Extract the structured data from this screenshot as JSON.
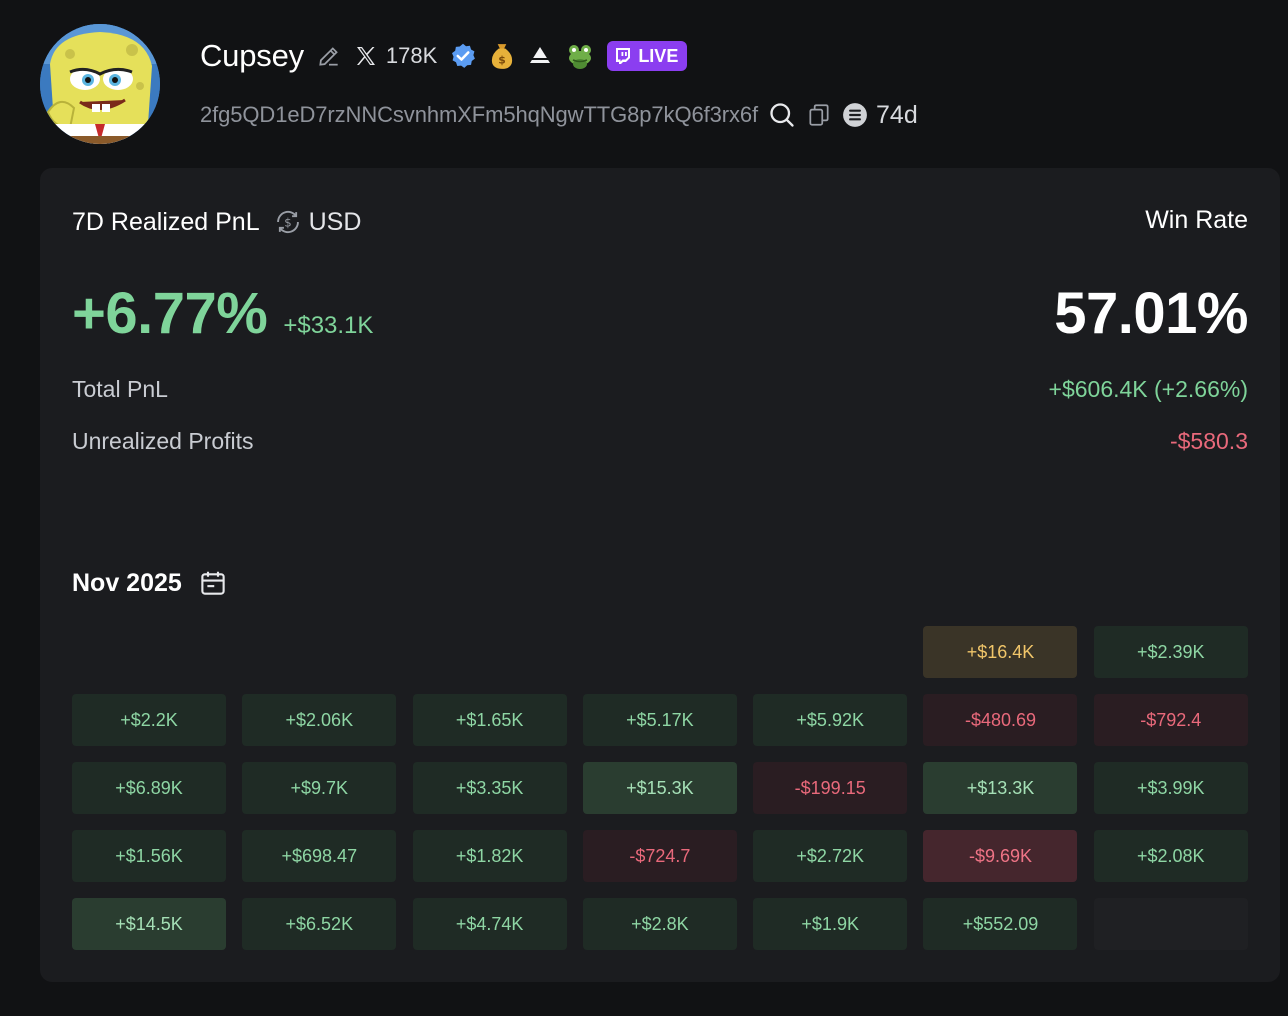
{
  "profile": {
    "name": "Cupsey",
    "followers": "178K",
    "live_label": "LIVE",
    "address": "2fg5QD1eD7rzNNCsvnhmXFm5hqNgwTTG8p7kQ6f3rx6f",
    "age": "74d"
  },
  "pnl": {
    "title": "7D Realized PnL",
    "currency": "USD",
    "percent": "+6.77%",
    "usd": "+$33.1K",
    "win_rate_label": "Win Rate",
    "win_rate": "57.01%",
    "total_label": "Total PnL",
    "total_value": "+$606.4K (+2.66%)",
    "unrealized_label": "Unrealized Profits",
    "unrealized_value": "-$580.3"
  },
  "calendar": {
    "month": "Nov 2025",
    "cells": [
      {
        "text": "",
        "kind": "empty"
      },
      {
        "text": "",
        "kind": "empty"
      },
      {
        "text": "",
        "kind": "empty"
      },
      {
        "text": "",
        "kind": "empty"
      },
      {
        "text": "",
        "kind": "empty"
      },
      {
        "text": "+$16.4K",
        "kind": "gold"
      },
      {
        "text": "+$2.39K",
        "kind": "pos"
      },
      {
        "text": "+$2.2K",
        "kind": "pos"
      },
      {
        "text": "+$2.06K",
        "kind": "pos"
      },
      {
        "text": "+$1.65K",
        "kind": "pos"
      },
      {
        "text": "+$5.17K",
        "kind": "pos"
      },
      {
        "text": "+$5.92K",
        "kind": "pos"
      },
      {
        "text": "-$480.69",
        "kind": "neg"
      },
      {
        "text": "-$792.4",
        "kind": "neg"
      },
      {
        "text": "+$6.89K",
        "kind": "pos"
      },
      {
        "text": "+$9.7K",
        "kind": "pos"
      },
      {
        "text": "+$3.35K",
        "kind": "pos"
      },
      {
        "text": "+$15.3K",
        "kind": "pos hi"
      },
      {
        "text": "-$199.15",
        "kind": "neg"
      },
      {
        "text": "+$13.3K",
        "kind": "pos hi"
      },
      {
        "text": "+$3.99K",
        "kind": "pos"
      },
      {
        "text": "+$1.56K",
        "kind": "pos"
      },
      {
        "text": "+$698.47",
        "kind": "pos"
      },
      {
        "text": "+$1.82K",
        "kind": "pos"
      },
      {
        "text": "-$724.7",
        "kind": "neg"
      },
      {
        "text": "+$2.72K",
        "kind": "pos"
      },
      {
        "text": "-$9.69K",
        "kind": "neg hi"
      },
      {
        "text": "+$2.08K",
        "kind": "pos"
      },
      {
        "text": "+$14.5K",
        "kind": "pos hi"
      },
      {
        "text": "+$6.52K",
        "kind": "pos"
      },
      {
        "text": "+$4.74K",
        "kind": "pos"
      },
      {
        "text": "+$2.8K",
        "kind": "pos"
      },
      {
        "text": "+$1.9K",
        "kind": "pos"
      },
      {
        "text": "+$552.09",
        "kind": "pos"
      },
      {
        "text": "",
        "kind": "blank"
      }
    ]
  },
  "colors": {
    "background": "#111214",
    "card": "#1b1c1f",
    "positive": "#7fd49a",
    "negative": "#e9697b",
    "live": "#8b3ef0",
    "verified": "#5b9cf2"
  },
  "icons": [
    "edit-pencil-icon",
    "x-logo-icon",
    "verified-badge-icon",
    "money-bag-icon",
    "triangle-logo-icon",
    "frog-icon",
    "twitch-icon",
    "search-icon",
    "copy-icon",
    "chain-icon",
    "currency-swap-icon",
    "calendar-icon"
  ]
}
